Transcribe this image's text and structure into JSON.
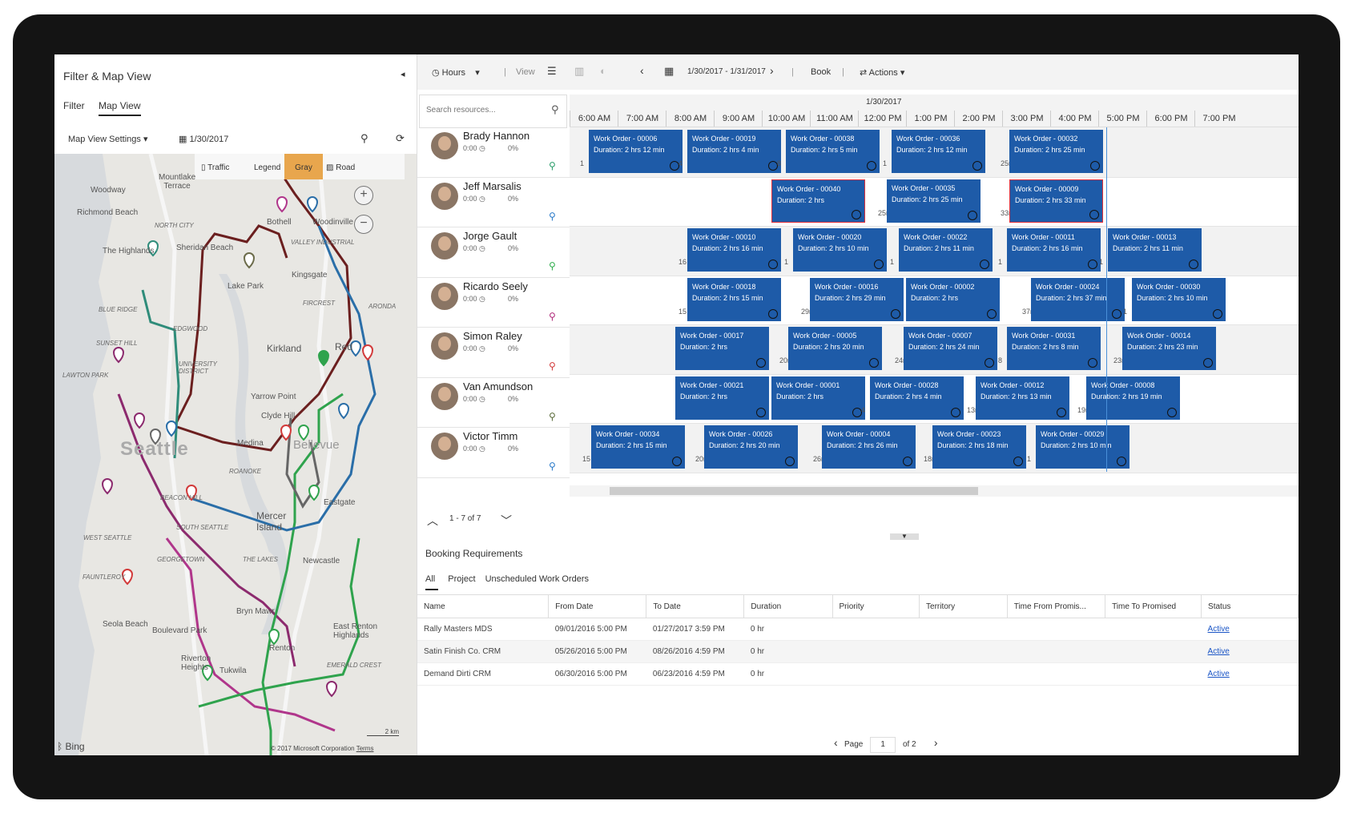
{
  "left_panel": {
    "title": "Filter & Map View",
    "collapse_icon": "◂",
    "tabs": [
      "Filter",
      "Map View"
    ],
    "map_settings_label": "Map View Settings",
    "date": "1/30/2017",
    "map_toolbar": {
      "traffic": "Traffic",
      "legend": "Legend",
      "gray": "Gray",
      "road": "Road"
    },
    "map_labels": {
      "seattle": "Seattle",
      "kirkland": "Kirkland",
      "bellevue": "Bellevue",
      "redmond": "Red",
      "medina": "Medina",
      "mercer": "Mercer\nIsland",
      "newcastle": "Newcastle",
      "eastgate": "Eastgate",
      "kingsgate": "Kingsgate",
      "lakepark": "Lake Park",
      "bothell": "Bothell",
      "woodinville": "Woodinville",
      "woodway": "Woodway",
      "richmond": "Richmond Beach",
      "mountlake": "Mountlake\nTerrace",
      "sheridan": "Sheridan Beach",
      "highlands": "The Highlands",
      "yarrow": "Yarrow Point",
      "clydehill": "Clyde Hill",
      "brynmawr": "Bryn Mawr",
      "boulevard": "Boulevard Park",
      "seola": "Seola Beach",
      "renton": "Renton",
      "eastrenton": "East Renton\nHighlands",
      "riverton": "Riverton\nHeights",
      "tukwila": "Tukwila",
      "northcity": "North City",
      "valley": "Valley Industrial",
      "blueridge": "Blue Ridge",
      "sunset": "Sunset Hill",
      "lawton": "Lawton Park",
      "edgwood": "Edgwood",
      "univ": "University\nDistrict",
      "finn": "Fircrest",
      "aronda": "Aronda",
      "roanoke": "Roanoke",
      "beacon": "Beacon Hill",
      "southseattle": "South Seattle",
      "westseattle": "West Seattle",
      "georgetown": "Georgetown",
      "fauntleroy": "Fauntleroy",
      "thelakes": "The Lakes",
      "emerald": "Emerald Crest"
    },
    "map_zoom_in": "+",
    "map_zoom_out": "−",
    "map_attribution": "Bing",
    "map_copyright": "© 2017 Microsoft Corporation",
    "map_terms": "Terms",
    "map_scale": "2 km"
  },
  "toolbar": {
    "hours": "Hours",
    "view": "View",
    "date_range": "1/30/2017 - 1/31/2017",
    "book": "Book",
    "actions": "Actions"
  },
  "schedule": {
    "search_placeholder": "Search resources...",
    "day": "1/30/2017",
    "hours": [
      "6:00 AM",
      "7:00 AM",
      "8:00 AM",
      "9:00 AM",
      "10:00 AM",
      "11:00 AM",
      "12:00 PM",
      "1:00 PM",
      "2:00 PM",
      "3:00 PM",
      "4:00 PM",
      "5:00 PM",
      "6:00 PM",
      "7:00 PM"
    ],
    "resources": [
      {
        "name": "Brady Hannon",
        "hours": "0:00",
        "pct": "0%",
        "pin_color": "#2a9d6a"
      },
      {
        "name": "Jeff Marsalis",
        "hours": "0:00",
        "pct": "0%",
        "pin_color": "#2a7ac9"
      },
      {
        "name": "Jorge Gault",
        "hours": "0:00",
        "pct": "0%",
        "pin_color": "#2fae4d"
      },
      {
        "name": "Ricardo Seely",
        "hours": "0:00",
        "pct": "0%",
        "pin_color": "#b02a7a"
      },
      {
        "name": "Simon Raley",
        "hours": "0:00",
        "pct": "0%",
        "pin_color": "#d23a3a"
      },
      {
        "name": "Van Amundson",
        "hours": "0:00",
        "pct": "0%",
        "pin_color": "#5a6b3a"
      },
      {
        "name": "Victor Timm",
        "hours": "0:00",
        "pct": "0%",
        "pin_color": "#2a7ac9"
      }
    ],
    "bookings": [
      [
        {
          "title": "Work Order - 00006",
          "duration": "Duration: 2 hrs 12 min",
          "start": 6.2,
          "len": 2.0,
          "travel_before": "1"
        },
        {
          "title": "Work Order - 00019",
          "duration": "Duration: 2 hrs 4 min",
          "start": 8.25,
          "len": 2.0,
          "travel_before": "4"
        },
        {
          "title": "Work Order - 00038",
          "duration": "Duration: 2 hrs 5 min",
          "start": 10.3,
          "len": 2.0,
          "travel_before": "8"
        },
        {
          "title": "Work Order - 00036",
          "duration": "Duration: 2 hrs 12 min",
          "start": 12.5,
          "len": 2.0,
          "travel_before": "1"
        },
        {
          "title": "Work Order - 00032",
          "duration": "Duration: 2 hrs 25 min",
          "start": 14.95,
          "len": 2.0,
          "travel_before": "25m"
        }
      ],
      [
        {
          "title": "Work Order - 00040",
          "duration": "Duration: 2 hrs",
          "start": 10.0,
          "len": 2.0,
          "red": true
        },
        {
          "title": "Work Order - 00035",
          "duration": "Duration: 2 hrs 25 min",
          "start": 12.4,
          "len": 2.0,
          "travel_before": "25m"
        },
        {
          "title": "Work Order - 00009",
          "duration": "Duration: 2 hrs 33 min",
          "start": 14.95,
          "len": 2.0,
          "travel_before": "33m",
          "red": true
        }
      ],
      [
        {
          "title": "Work Order - 00010",
          "duration": "Duration: 2 hrs 16 min",
          "start": 8.25,
          "len": 2.0,
          "travel_before": "16"
        },
        {
          "title": "Work Order - 00020",
          "duration": "Duration: 2 hrs 10 min",
          "start": 10.45,
          "len": 2.0,
          "travel_before": "1"
        },
        {
          "title": "Work Order - 00022",
          "duration": "Duration: 2 hrs 11 min",
          "start": 12.65,
          "len": 2.0,
          "travel_before": "1"
        },
        {
          "title": "Work Order - 00011",
          "duration": "Duration: 2 hrs 16 min",
          "start": 14.9,
          "len": 2.0,
          "travel_before": "1"
        },
        {
          "title": "Work Order - 00013",
          "duration": "Duration: 2 hrs 11 min",
          "start": 17.0,
          "len": 2.0,
          "travel_before": "1"
        }
      ],
      [
        {
          "title": "Work Order - 00018",
          "duration": "Duration: 2 hrs 15 min",
          "start": 8.25,
          "len": 2.0,
          "travel_before": "15"
        },
        {
          "title": "Work Order - 00016",
          "duration": "Duration: 2 hrs 29 min",
          "start": 10.8,
          "len": 2.0,
          "travel_before": "29m"
        },
        {
          "title": "Work Order - 00002",
          "duration": "Duration: 2 hrs",
          "start": 12.8,
          "len": 2.0
        },
        {
          "title": "Work Order - 00024",
          "duration": "Duration: 2 hrs 37 min",
          "start": 15.4,
          "len": 2.0,
          "travel_before": "37m"
        },
        {
          "title": "Work Order - 00030",
          "duration": "Duration: 2 hrs 10 min",
          "start": 17.5,
          "len": 2.0,
          "travel_before": "1"
        }
      ],
      [
        {
          "title": "Work Order - 00017",
          "duration": "Duration: 2 hrs",
          "start": 8.0,
          "len": 2.0
        },
        {
          "title": "Work Order - 00005",
          "duration": "Duration: 2 hrs 20 min",
          "start": 10.35,
          "len": 2.0,
          "travel_before": "20m"
        },
        {
          "title": "Work Order - 00007",
          "duration": "Duration: 2 hrs 24 min",
          "start": 12.75,
          "len": 2.0,
          "travel_before": "24m"
        },
        {
          "title": "Work Order - 00031",
          "duration": "Duration: 2 hrs 8 min",
          "start": 14.9,
          "len": 2.0,
          "travel_before": "8"
        },
        {
          "title": "Work Order - 00014",
          "duration": "Duration: 2 hrs 23 min",
          "start": 17.3,
          "len": 2.0,
          "travel_before": "23m"
        }
      ],
      [
        {
          "title": "Work Order - 00021",
          "duration": "Duration: 2 hrs",
          "start": 8.0,
          "len": 2.0
        },
        {
          "title": "Work Order - 00001",
          "duration": "Duration: 2 hrs",
          "start": 10.0,
          "len": 2.0
        },
        {
          "title": "Work Order - 00028",
          "duration": "Duration: 2 hrs 4 min",
          "start": 12.05,
          "len": 2.0,
          "travel_before": "4"
        },
        {
          "title": "Work Order - 00012",
          "duration": "Duration: 2 hrs 13 min",
          "start": 14.25,
          "len": 2.0,
          "travel_before": "13m"
        },
        {
          "title": "Work Order - 00008",
          "duration": "Duration: 2 hrs 19 min",
          "start": 16.55,
          "len": 2.0,
          "travel_before": "19m"
        }
      ],
      [
        {
          "title": "Work Order - 00034",
          "duration": "Duration: 2 hrs 15 min",
          "start": 6.25,
          "len": 2.0,
          "travel_before": "15"
        },
        {
          "title": "Work Order - 00026",
          "duration": "Duration: 2 hrs 20 min",
          "start": 8.6,
          "len": 2.0,
          "travel_before": "20m"
        },
        {
          "title": "Work Order - 00004",
          "duration": "Duration: 2 hrs 26 min",
          "start": 11.05,
          "len": 2.0,
          "travel_before": "26m"
        },
        {
          "title": "Work Order - 00023",
          "duration": "Duration: 2 hrs 18 min",
          "start": 13.35,
          "len": 2.0,
          "travel_before": "18m"
        },
        {
          "title": "Work Order - 00029",
          "duration": "Duration: 2 hrs 10 min",
          "start": 15.5,
          "len": 2.0,
          "travel_before": "1"
        }
      ]
    ],
    "pager": "1 - 7 of 7"
  },
  "booking_requirements": {
    "title": "Booking Requirements",
    "tabs": [
      "All",
      "Project",
      "Unscheduled Work Orders"
    ],
    "columns": [
      "Name",
      "From Date",
      "To Date",
      "Duration",
      "Priority",
      "Territory",
      "Time From Promis...",
      "Time To Promised",
      "Status"
    ],
    "rows": [
      [
        "Rally Masters MDS",
        "09/01/2016 5:00 PM",
        "01/27/2017 3:59 PM",
        "0 hr",
        "",
        "",
        "",
        "",
        "Active"
      ],
      [
        "Satin Finish Co. CRM",
        "05/26/2016 5:00 PM",
        "08/26/2016 4:59 PM",
        "0 hr",
        "",
        "",
        "",
        "",
        "Active"
      ],
      [
        "Demand Dirti CRM",
        "06/30/2016 5:00 PM",
        "06/23/2016 4:59 PM",
        "0 hr",
        "",
        "",
        "",
        "",
        "Active"
      ]
    ],
    "pager": {
      "label": "Page",
      "page": "1",
      "of": "of 2"
    }
  }
}
